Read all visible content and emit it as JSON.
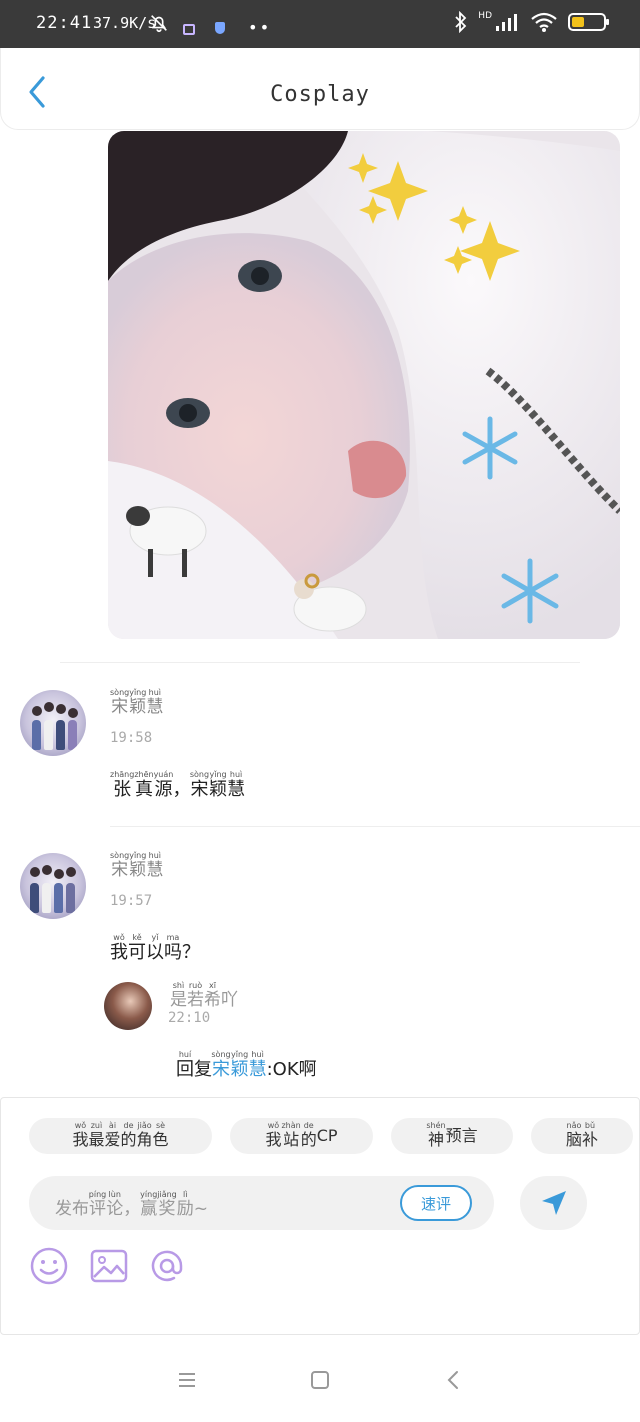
{
  "status_bar": {
    "time": "22:41",
    "net_speed": "37.9K/s",
    "network_label": "HD"
  },
  "header": {
    "title": "Cosplay"
  },
  "comments": [
    {
      "author": [
        {
          "c": "宋",
          "p": "sòng"
        },
        {
          "c": "颖",
          "p": "yǐng"
        },
        {
          "c": "慧",
          "p": "huì"
        }
      ],
      "time": "19:58",
      "body": [
        {
          "c": "张",
          "p": "zhāng"
        },
        {
          "c": "真",
          "p": "zhēn"
        },
        {
          "c": "源",
          "p": "yuán"
        },
        {
          "c": "，",
          "p": ""
        },
        {
          "c": "宋",
          "p": "sòng"
        },
        {
          "c": "颖",
          "p": "yǐng"
        },
        {
          "c": "慧",
          "p": "huì"
        }
      ]
    },
    {
      "author": [
        {
          "c": "宋",
          "p": "sòng"
        },
        {
          "c": "颖",
          "p": "yǐng"
        },
        {
          "c": "慧",
          "p": "huì"
        }
      ],
      "time": "19:57",
      "body": [
        {
          "c": "我",
          "p": "wǒ"
        },
        {
          "c": "可",
          "p": "kě"
        },
        {
          "c": "以",
          "p": "yǐ"
        },
        {
          "c": "吗",
          "p": "ma"
        },
        {
          "c": "？",
          "p": ""
        }
      ],
      "reply": {
        "author": [
          {
            "c": "是",
            "p": "shì"
          },
          {
            "c": "若",
            "p": "ruò"
          },
          {
            "c": "希",
            "p": "xī"
          },
          {
            "c": "吖",
            "p": ""
          }
        ],
        "time": "22:10",
        "prefix": [
          {
            "c": "回",
            "p": "huí"
          },
          {
            "c": "复",
            "p": ""
          }
        ],
        "mention": [
          {
            "c": "宋",
            "p": "sòng"
          },
          {
            "c": "颖",
            "p": "yǐng"
          },
          {
            "c": "慧",
            "p": "huì"
          }
        ],
        "suffix": ":OK啊"
      }
    }
  ],
  "composer": {
    "tags": [
      [
        {
          "c": "我",
          "p": "wǒ"
        },
        {
          "c": "最",
          "p": "zuì"
        },
        {
          "c": "爱",
          "p": "ài"
        },
        {
          "c": "的",
          "p": "de"
        },
        {
          "c": "角",
          "p": "jiǎo"
        },
        {
          "c": "色",
          "p": "sè"
        }
      ],
      [
        {
          "c": "我",
          "p": "wǒ"
        },
        {
          "c": "站",
          "p": "zhàn"
        },
        {
          "c": "的",
          "p": "de"
        },
        {
          "c": "CP",
          "p": ""
        }
      ],
      [
        {
          "c": "神",
          "p": "shén"
        },
        {
          "c": "预",
          "p": ""
        },
        {
          "c": "言",
          "p": ""
        }
      ],
      [
        {
          "c": "脑",
          "p": "nǎo"
        },
        {
          "c": "补",
          "p": "bǔ"
        }
      ]
    ],
    "placeholder": [
      {
        "c": "发",
        "p": ""
      },
      {
        "c": "布",
        "p": ""
      },
      {
        "c": "评",
        "p": "píng"
      },
      {
        "c": "论",
        "p": "lùn"
      },
      {
        "c": "，",
        "p": ""
      },
      {
        "c": "赢",
        "p": "yíng"
      },
      {
        "c": "奖",
        "p": "jiǎng"
      },
      {
        "c": "励",
        "p": "lì"
      },
      {
        "c": "~",
        "p": ""
      }
    ],
    "quick_label": "速评"
  },
  "colors": {
    "accent": "#3a9ad9",
    "tool_purple": "#b89ae6",
    "status_bar": "#3a3a3a"
  },
  "icons": [
    "back-arrow-icon",
    "send-icon",
    "emoji-icon",
    "image-icon",
    "at-icon",
    "menu-icon",
    "home-icon",
    "nav-back-icon"
  ]
}
